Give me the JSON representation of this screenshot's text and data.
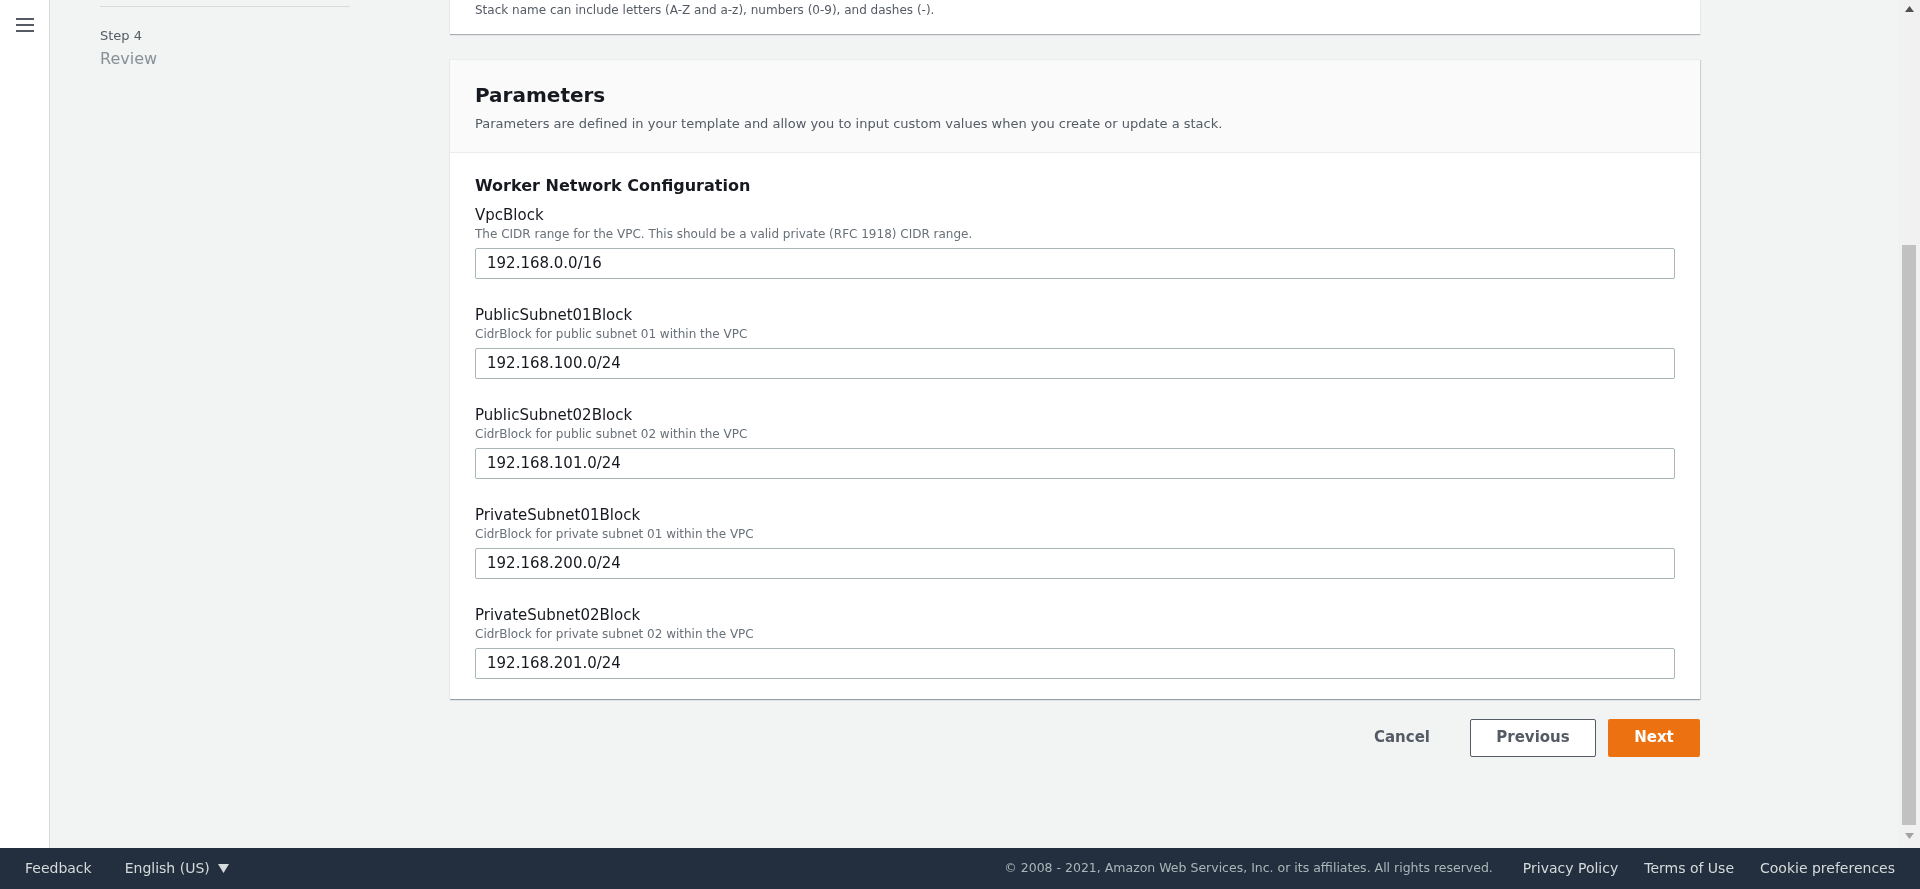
{
  "sidebar": {
    "steps": [
      {
        "label": "Step 4",
        "name": "Review"
      }
    ]
  },
  "stack_name_card": {
    "hint": "Stack name can include letters (A-Z and a-z), numbers (0-9), and dashes (-)."
  },
  "parameters": {
    "title": "Parameters",
    "description": "Parameters are defined in your template and allow you to input custom values when you create or update a stack.",
    "groups": [
      {
        "title": "Worker Network Configuration",
        "fields": [
          {
            "label": "VpcBlock",
            "description": "The CIDR range for the VPC. This should be a valid private (RFC 1918) CIDR range.",
            "value": "192.168.0.0/16"
          },
          {
            "label": "PublicSubnet01Block",
            "description": "CidrBlock for public subnet 01 within the VPC",
            "value": "192.168.100.0/24"
          },
          {
            "label": "PublicSubnet02Block",
            "description": "CidrBlock for public subnet 02 within the VPC",
            "value": "192.168.101.0/24"
          },
          {
            "label": "PrivateSubnet01Block",
            "description": "CidrBlock for private subnet 01 within the VPC",
            "value": "192.168.200.0/24"
          },
          {
            "label": "PrivateSubnet02Block",
            "description": "CidrBlock for private subnet 02 within the VPC",
            "value": "192.168.201.0/24"
          }
        ]
      }
    ]
  },
  "actions": [
    {
      "label": "Cancel",
      "kind": "link"
    },
    {
      "label": "Previous",
      "kind": "secondary"
    },
    {
      "label": "Next",
      "kind": "primary"
    }
  ],
  "footer": {
    "left": [
      "Feedback",
      "English (US)"
    ],
    "copyright": "© 2008 - 2021, Amazon Web Services, Inc. or its affiliates. All rights reserved.",
    "links": [
      "Privacy Policy",
      "Terms of Use",
      "Cookie preferences"
    ]
  }
}
